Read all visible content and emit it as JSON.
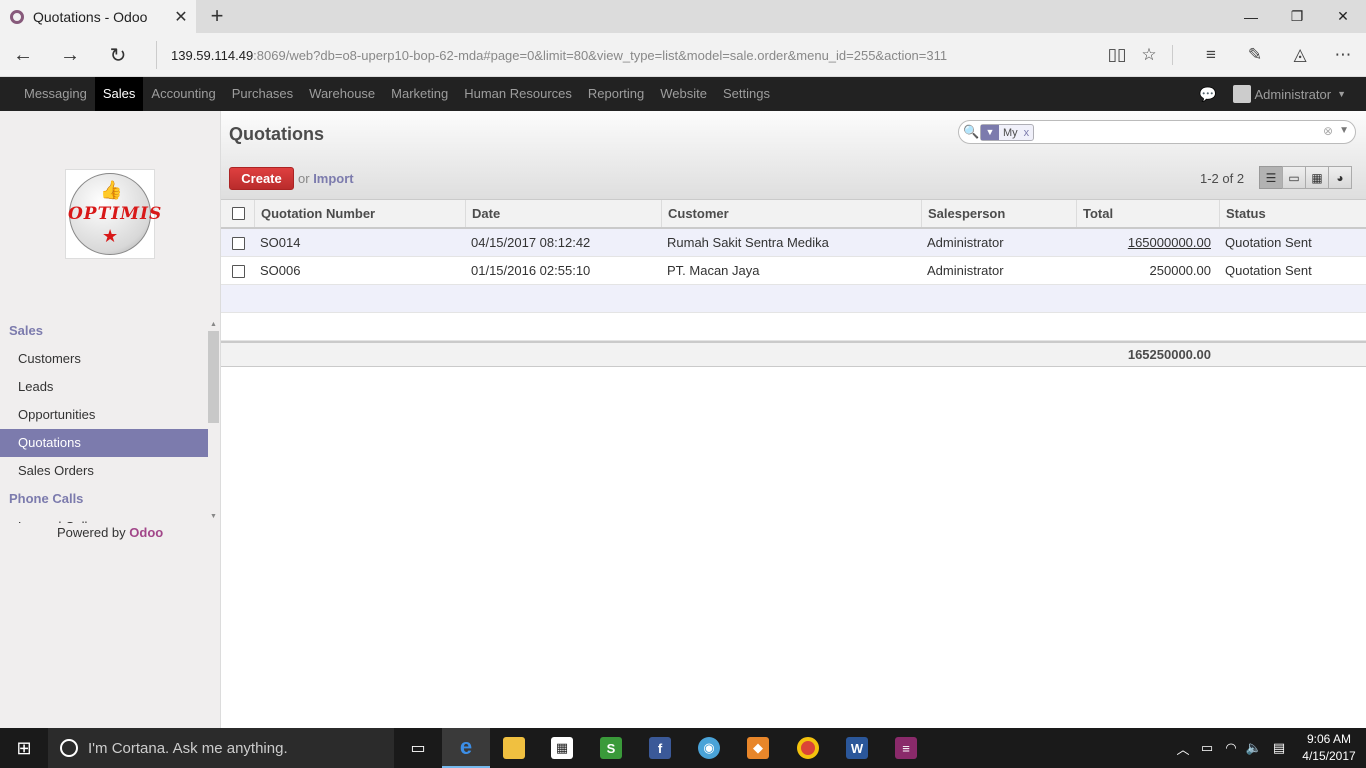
{
  "browser": {
    "tab_title": "Quotations - Odoo",
    "url_host": "139.59.114.49",
    "url_rest": ":8069/web?db=o8-uperp10-bop-62-mda#page=0&limit=80&view_type=list&model=sale.order&menu_id=255&action=311"
  },
  "topmenu": {
    "items": [
      "Messaging",
      "Sales",
      "Accounting",
      "Purchases",
      "Warehouse",
      "Marketing",
      "Human Resources",
      "Reporting",
      "Website",
      "Settings"
    ],
    "active": "Sales",
    "user": "Administrator"
  },
  "sidebar": {
    "logo_text": "OPTIMIS",
    "sections": [
      {
        "title": "Sales",
        "items": [
          "Customers",
          "Leads",
          "Opportunities",
          "Quotations",
          "Sales Orders"
        ]
      },
      {
        "title": "Phone Calls",
        "items": [
          "Logged Calls"
        ]
      }
    ],
    "active_item": "Quotations",
    "powered_by": "Powered by",
    "powered_brand": "Odoo"
  },
  "view": {
    "title": "Quotations",
    "search_facet": "My",
    "facet_remove": "x",
    "create_label": "Create",
    "or_label": "or",
    "import_label": "Import",
    "pager": "1-2 of 2"
  },
  "table": {
    "columns": [
      "Quotation Number",
      "Date",
      "Customer",
      "Salesperson",
      "Total",
      "Status"
    ],
    "rows": [
      {
        "number": "SO014",
        "date": "04/15/2017 08:12:42",
        "customer": "Rumah Sakit Sentra Medika",
        "salesperson": "Administrator",
        "total": "165000000.00",
        "status": "Quotation Sent"
      },
      {
        "number": "SO006",
        "date": "01/15/2016 02:55:10",
        "customer": "PT. Macan Jaya",
        "salesperson": "Administrator",
        "total": "250000.00",
        "status": "Quotation Sent"
      }
    ],
    "grand_total": "165250000.00"
  },
  "taskbar": {
    "cortana_text": "I'm Cortana. Ask me anything.",
    "time": "9:06 AM",
    "date": "4/15/2017"
  },
  "colors": {
    "odoo_purple": "#7c7bad",
    "create_red": "#d03b3b",
    "topbar": "#222222"
  }
}
